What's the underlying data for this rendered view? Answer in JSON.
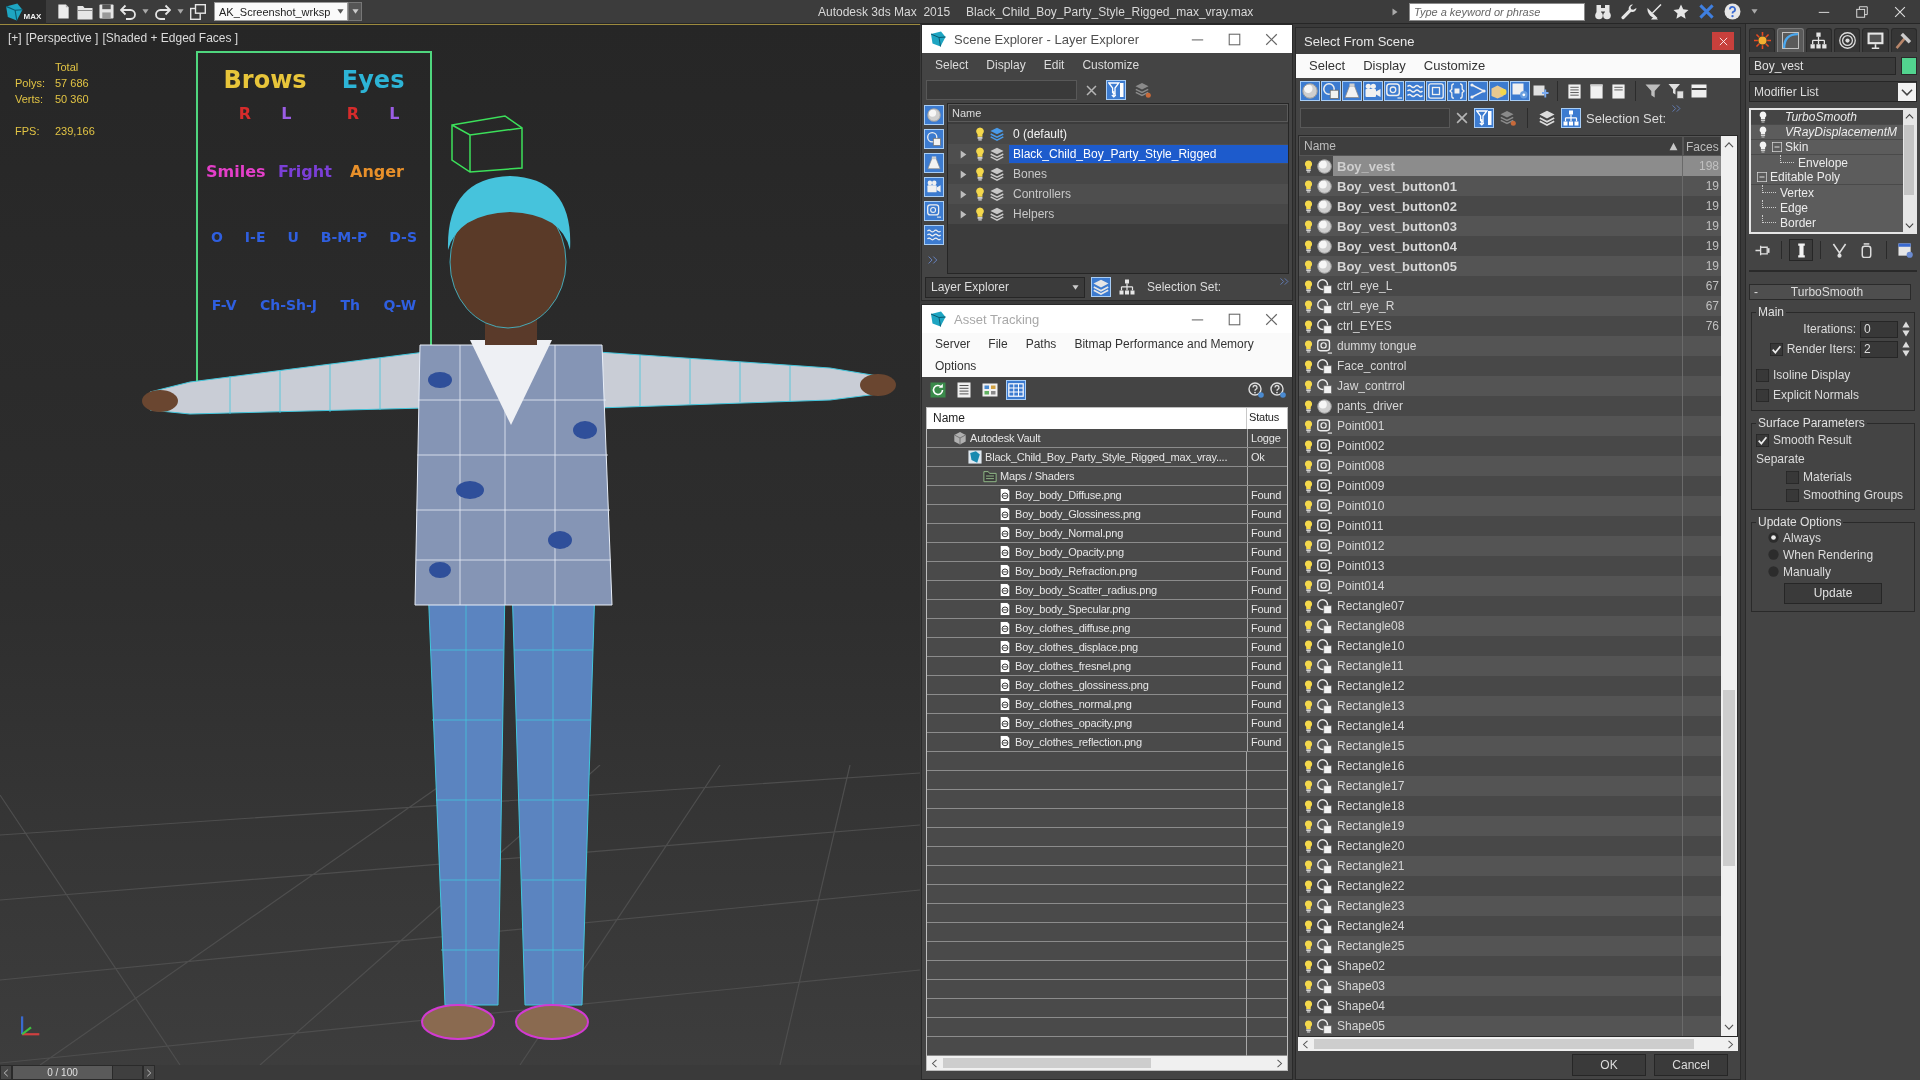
{
  "app_bar": {
    "logo_text": "MAX",
    "workspace": "AK_Screenshot_wrksp",
    "app_title": "Autodesk 3ds Max  2015",
    "file_name": "Black_Child_Boy_Party_Style_Rigged_max_vray.max",
    "search": {
      "placeholder": "Type a keyword or phrase"
    }
  },
  "viewport": {
    "labels": [
      "[+]",
      "[Perspective ]",
      "[Shaded + Edged Faces ]"
    ],
    "stats": {
      "header": "Total",
      "rows": [
        {
          "label": "Polys:",
          "value": "57 686"
        },
        {
          "label": "Verts:",
          "value": "50 360"
        }
      ]
    },
    "fps": {
      "label": "FPS:",
      "value": "239,166"
    },
    "control_board": {
      "sections": [
        {
          "title": {
            "text": "Brows",
            "color": "#e8c53a"
          },
          "labels": [
            {
              "text": "R",
              "color": "#d62b2b"
            },
            {
              "text": "L",
              "color": "#9b5de5"
            }
          ]
        },
        {
          "title": {
            "text": "Eyes",
            "color": "#2db4d6"
          },
          "labels": [
            {
              "text": "R",
              "color": "#d62b2b"
            },
            {
              "text": "L",
              "color": "#9b5de5"
            }
          ]
        }
      ],
      "expressions": [
        {
          "text": "Smiles",
          "color": "#e43fc9"
        },
        {
          "text": "Fright",
          "color": "#7b3fd6"
        },
        {
          "text": "Anger",
          "color": "#e8902a"
        }
      ],
      "phonemes": [
        {
          "text": "O",
          "color": "#2f5fe0"
        },
        {
          "text": "I-E",
          "color": "#2f5fe0"
        },
        {
          "text": "U",
          "color": "#2f5fe0"
        },
        {
          "text": "B-M-P",
          "color": "#2f5fe0"
        },
        {
          "text": "D-S",
          "color": "#2f5fe0"
        },
        {
          "text": "F-V",
          "color": "#2f5fe0"
        },
        {
          "text": "Ch-Sh-J",
          "color": "#2f5fe0"
        },
        {
          "text": "Th",
          "color": "#2f5fe0"
        },
        {
          "text": "Q-W",
          "color": "#2f5fe0"
        }
      ]
    }
  },
  "time_slider": {
    "value": "0 / 100",
    "level": 0
  },
  "scene_explorer": {
    "title": "Scene Explorer - Layer Explorer",
    "active": true,
    "menu": [
      "Select",
      "Display",
      "Edit",
      "Customize"
    ],
    "filter_toggle": {
      "on": true
    },
    "display_filters": [
      {
        "on": true
      },
      {
        "on": true
      },
      {
        "on": true
      },
      {
        "on": true
      },
      {
        "on": true
      },
      {
        "on": true
      }
    ],
    "column": "Name",
    "layers": [
      {
        "name": "0 (default)",
        "collapsed": false,
        "current": true,
        "selected": false
      },
      {
        "name": "Black_Child_Boy_Party_Style_Rigged",
        "collapsed": true,
        "current": false,
        "selected": true
      },
      {
        "name": "Bones",
        "collapsed": true,
        "current": false,
        "selected": false
      },
      {
        "name": "Controllers",
        "collapsed": true,
        "current": false,
        "selected": false
      },
      {
        "name": "Helpers",
        "collapsed": true,
        "current": false,
        "selected": false
      }
    ],
    "explorer_type": "Layer Explorer",
    "view_buttons": [
      {
        "selected": true
      },
      {
        "selected": false
      }
    ],
    "selection_set_label": "Selection Set:"
  },
  "asset_tracking": {
    "title": "Asset Tracking",
    "active": false,
    "menu": [
      "Server",
      "File",
      "Paths",
      "Bitmap Performance and Memory",
      "Options"
    ],
    "toolbar": [
      {
        "selected": false
      },
      {
        "selected": false
      },
      {
        "selected": false
      },
      {
        "selected": true
      }
    ],
    "columns": [
      "Name",
      "Status"
    ],
    "assets": [
      {
        "kind": "vault",
        "name": "Autodesk Vault",
        "status": "Logge",
        "children": [
          {
            "kind": "file",
            "name": "Black_Child_Boy_Party_Style_Rigged_max_vray....",
            "status": "Ok",
            "children": [
              {
                "kind": "folder",
                "name": "Maps / Shaders",
                "children": [
                  {
                    "kind": "map",
                    "name": "Boy_body_Diffuse.png",
                    "status": "Found"
                  },
                  {
                    "kind": "map",
                    "name": "Boy_body_Glossiness.png",
                    "status": "Found"
                  },
                  {
                    "kind": "map",
                    "name": "Boy_body_Normal.png",
                    "status": "Found"
                  },
                  {
                    "kind": "map",
                    "name": "Boy_body_Opacity.png",
                    "status": "Found"
                  },
                  {
                    "kind": "map",
                    "name": "Boy_body_Refraction.png",
                    "status": "Found"
                  },
                  {
                    "kind": "map",
                    "name": "Boy_body_Scatter_radius.png",
                    "status": "Found"
                  },
                  {
                    "kind": "map",
                    "name": "Boy_body_Specular.png",
                    "status": "Found"
                  },
                  {
                    "kind": "map",
                    "name": "Boy_clothes_diffuse.png",
                    "status": "Found"
                  },
                  {
                    "kind": "map",
                    "name": "Boy_clothes_displace.png",
                    "status": "Found"
                  },
                  {
                    "kind": "map",
                    "name": "Boy_clothes_fresnel.png",
                    "status": "Found"
                  },
                  {
                    "kind": "map",
                    "name": "Boy_clothes_glossiness.png",
                    "status": "Found"
                  },
                  {
                    "kind": "map",
                    "name": "Boy_clothes_normal.png",
                    "status": "Found"
                  },
                  {
                    "kind": "map",
                    "name": "Boy_clothes_opacity.png",
                    "status": "Found"
                  },
                  {
                    "kind": "map",
                    "name": "Boy_clothes_reflection.png",
                    "status": "Found"
                  }
                ]
              }
            ]
          }
        ]
      }
    ]
  },
  "select_from_scene": {
    "title": "Select From Scene",
    "active": true,
    "menu": [
      "Select",
      "Display",
      "Customize"
    ],
    "type_filters": [
      {
        "on": true
      },
      {
        "on": true
      },
      {
        "on": true
      },
      {
        "on": true
      },
      {
        "on": true
      },
      {
        "on": true
      },
      {
        "on": true
      },
      {
        "on": true
      },
      {
        "on": true
      },
      {
        "on": true
      },
      {
        "on": true
      },
      {
        "on": false
      }
    ],
    "filter_toggle": {
      "on": true
    },
    "hierarchy_toggle": {
      "on": true
    },
    "selection_set_label": "Selection Set:",
    "columns": [
      "Name",
      "Faces"
    ],
    "objects": [
      {
        "name": "Boy_vest",
        "kind": "geometry",
        "bold": true,
        "selected": true,
        "faces": "198"
      },
      {
        "name": "Boy_vest_button01",
        "kind": "geometry",
        "bold": true,
        "selected": false,
        "faces": "19"
      },
      {
        "name": "Boy_vest_button02",
        "kind": "geometry",
        "bold": true,
        "selected": false,
        "faces": "19"
      },
      {
        "name": "Boy_vest_button03",
        "kind": "geometry",
        "bold": true,
        "selected": false,
        "faces": "19"
      },
      {
        "name": "Boy_vest_button04",
        "kind": "geometry",
        "bold": true,
        "selected": false,
        "faces": "19"
      },
      {
        "name": "Boy_vest_button05",
        "kind": "geometry",
        "bold": true,
        "selected": false,
        "faces": "19"
      },
      {
        "name": "ctrl_eye_L",
        "kind": "shape",
        "bold": false,
        "selected": false,
        "faces": "67"
      },
      {
        "name": "ctrl_eye_R",
        "kind": "shape",
        "bold": false,
        "selected": false,
        "faces": "67"
      },
      {
        "name": "ctrl_EYES",
        "kind": "shape",
        "bold": false,
        "selected": false,
        "faces": "76"
      },
      {
        "name": "dummy tongue",
        "kind": "helper",
        "bold": false,
        "selected": false
      },
      {
        "name": "Face_control",
        "kind": "shape",
        "bold": false,
        "selected": false
      },
      {
        "name": "Jaw_contrrol",
        "kind": "shape",
        "bold": false,
        "selected": false
      },
      {
        "name": "pants_driver",
        "kind": "geometry",
        "bold": false,
        "selected": false
      },
      {
        "name": "Point001",
        "kind": "helper",
        "bold": false,
        "selected": false
      },
      {
        "name": "Point002",
        "kind": "helper",
        "bold": false,
        "selected": false
      },
      {
        "name": "Point008",
        "kind": "helper",
        "bold": false,
        "selected": false
      },
      {
        "name": "Point009",
        "kind": "helper",
        "bold": false,
        "selected": false
      },
      {
        "name": "Point010",
        "kind": "helper",
        "bold": false,
        "selected": false
      },
      {
        "name": "Point011",
        "kind": "helper",
        "bold": false,
        "selected": false
      },
      {
        "name": "Point012",
        "kind": "helper",
        "bold": false,
        "selected": false
      },
      {
        "name": "Point013",
        "kind": "helper",
        "bold": false,
        "selected": false
      },
      {
        "name": "Point014",
        "kind": "helper",
        "bold": false,
        "selected": false
      },
      {
        "name": "Rectangle07",
        "kind": "shape",
        "bold": false,
        "selected": false
      },
      {
        "name": "Rectangle08",
        "kind": "shape",
        "bold": false,
        "selected": false
      },
      {
        "name": "Rectangle10",
        "kind": "shape",
        "bold": false,
        "selected": false
      },
      {
        "name": "Rectangle11",
        "kind": "shape",
        "bold": false,
        "selected": false
      },
      {
        "name": "Rectangle12",
        "kind": "shape",
        "bold": false,
        "selected": false
      },
      {
        "name": "Rectangle13",
        "kind": "shape",
        "bold": false,
        "selected": false
      },
      {
        "name": "Rectangle14",
        "kind": "shape",
        "bold": false,
        "selected": false
      },
      {
        "name": "Rectangle15",
        "kind": "shape",
        "bold": false,
        "selected": false
      },
      {
        "name": "Rectangle16",
        "kind": "shape",
        "bold": false,
        "selected": false
      },
      {
        "name": "Rectangle17",
        "kind": "shape",
        "bold": false,
        "selected": false
      },
      {
        "name": "Rectangle18",
        "kind": "shape",
        "bold": false,
        "selected": false
      },
      {
        "name": "Rectangle19",
        "kind": "shape",
        "bold": false,
        "selected": false
      },
      {
        "name": "Rectangle20",
        "kind": "shape",
        "bold": false,
        "selected": false
      },
      {
        "name": "Rectangle21",
        "kind": "shape",
        "bold": false,
        "selected": false
      },
      {
        "name": "Rectangle22",
        "kind": "shape",
        "bold": false,
        "selected": false
      },
      {
        "name": "Rectangle23",
        "kind": "shape",
        "bold": false,
        "selected": false
      },
      {
        "name": "Rectangle24",
        "kind": "shape",
        "bold": false,
        "selected": false
      },
      {
        "name": "Rectangle25",
        "kind": "shape",
        "bold": false,
        "selected": false
      },
      {
        "name": "Shape02",
        "kind": "shape",
        "bold": false,
        "selected": false
      },
      {
        "name": "Shape03",
        "kind": "shape",
        "bold": false,
        "selected": false
      },
      {
        "name": "Shape04",
        "kind": "shape",
        "bold": false,
        "selected": false
      },
      {
        "name": "Shape05",
        "kind": "shape",
        "bold": false,
        "selected": false
      }
    ],
    "buttons": [
      "OK",
      "Cancel"
    ]
  },
  "command_panel": {
    "tabs": [
      {
        "selected": false
      },
      {
        "selected": true
      },
      {
        "selected": false
      },
      {
        "selected": false
      },
      {
        "selected": false
      },
      {
        "selected": false
      }
    ],
    "object_name": "Boy_vest",
    "modifier_list": "Modifier List",
    "stack": [
      {
        "kind": "modifier",
        "name": "TurboSmooth",
        "italic": true,
        "selected": true
      },
      {
        "kind": "modifier",
        "name": "VRayDisplacementM",
        "italic": true,
        "selected": false
      },
      {
        "kind": "modifier",
        "name": "Skin",
        "italic": false,
        "selected": false,
        "expanded": true,
        "children": [
          {
            "name": "Envelope"
          }
        ]
      },
      {
        "kind": "base",
        "name": "Editable Poly",
        "italic": false,
        "selected": false,
        "expanded": true,
        "children": [
          {
            "name": "Vertex"
          },
          {
            "name": "Edge"
          },
          {
            "name": "Border"
          }
        ]
      }
    ],
    "tools": [
      {
        "selected": false
      },
      {
        "selected": true
      },
      {
        "selected": false
      },
      {
        "selected": false
      },
      {
        "selected": false
      }
    ],
    "rollout": {
      "toggle": "-",
      "title": "TurboSmooth",
      "groups": [
        {
          "title": "Main",
          "controls": [
            {
              "kind": "spinner",
              "label": "Iterations:",
              "value": "0"
            },
            {
              "kind": "check_spinner",
              "label": "Render Iters:",
              "checked": true,
              "value": "2"
            },
            {
              "kind": "checkbox",
              "label": "Isoline Display",
              "checked": false
            },
            {
              "kind": "checkbox",
              "label": "Explicit Normals",
              "checked": false
            }
          ]
        },
        {
          "title": "Surface Parameters",
          "controls": [
            {
              "kind": "checkbox",
              "label": "Smooth Result",
              "checked": true
            },
            {
              "kind": "label",
              "label": "Separate",
              "children": [
                {
                  "kind": "checkbox",
                  "label": "Materials",
                  "checked": false
                },
                {
                  "kind": "checkbox",
                  "label": "Smoothing Groups",
                  "checked": false
                }
              ]
            }
          ]
        },
        {
          "title": "Update Options",
          "controls": [
            {
              "kind": "radio",
              "label": "Always",
              "selected": true
            },
            {
              "kind": "radio",
              "label": "When Rendering",
              "selected": false
            },
            {
              "kind": "radio",
              "label": "Manually",
              "selected": false
            },
            {
              "kind": "button",
              "label": "Update"
            }
          ]
        }
      ]
    }
  }
}
